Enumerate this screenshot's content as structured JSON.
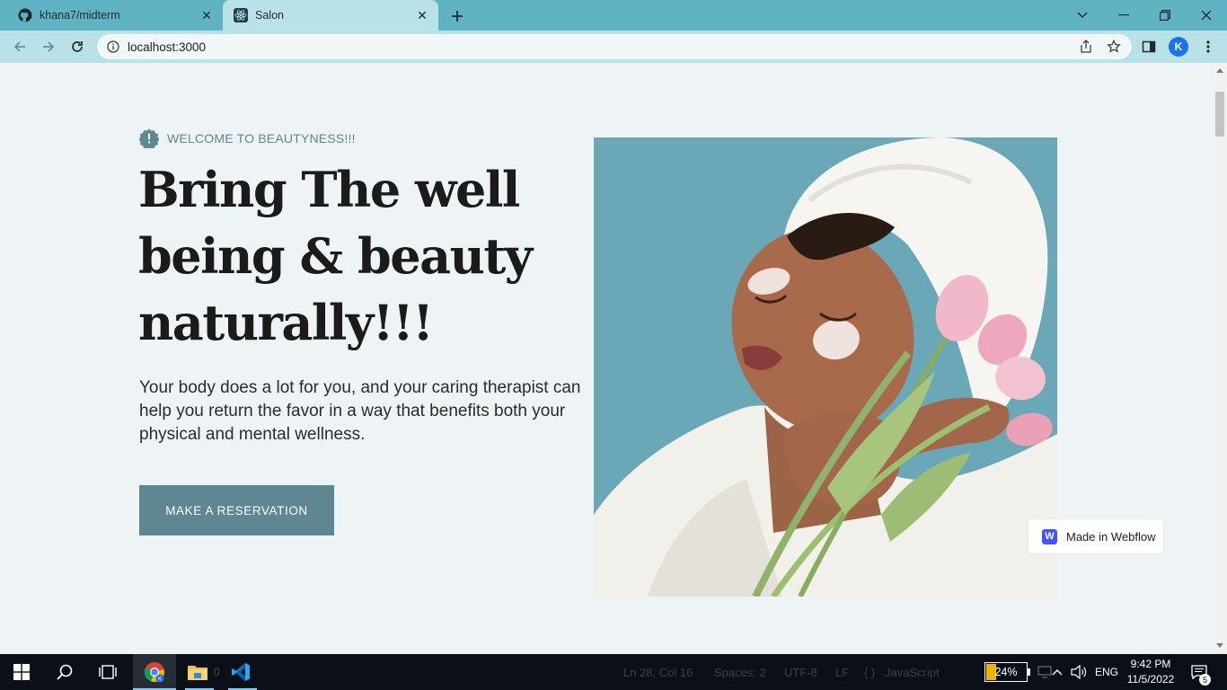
{
  "browser": {
    "tabs": [
      {
        "title": "khana7/midterm",
        "favicon": "github-icon",
        "active": false
      },
      {
        "title": "Salon",
        "favicon": "react-icon",
        "active": true
      }
    ],
    "url": "localhost:3000",
    "profile_initial": "K",
    "colors": {
      "tabstrip": "#5fb3c2",
      "toolbar": "#b9e1e8"
    }
  },
  "hero": {
    "eyebrow": "WELCOME TO BEAUTYNESS!!!",
    "headline_lines": [
      "Bring The well",
      "being & beauty",
      "naturally!!!"
    ],
    "lead": "Your body does a lot for you, and your caring therapist can help you return the favor in a way that benefits both your physical and mental wellness.",
    "cta_label": "MAKE A RESERVATION",
    "accent_color": "#5e8793"
  },
  "badge": {
    "logo_letter": "W",
    "label": "Made in Webflow"
  },
  "taskbar": {
    "vscode_status": {
      "position": "Ln 28, Col 16",
      "spaces": "Spaces: 2",
      "encoding": "UTF-8",
      "eol": "LF",
      "language": "JavaScript"
    },
    "file_explorer_count": "0",
    "battery_percent": "24%",
    "battery_level": 0.24,
    "language": "ENG",
    "time": "9:42 PM",
    "date": "11/5/2022",
    "notifications_count": "5"
  }
}
